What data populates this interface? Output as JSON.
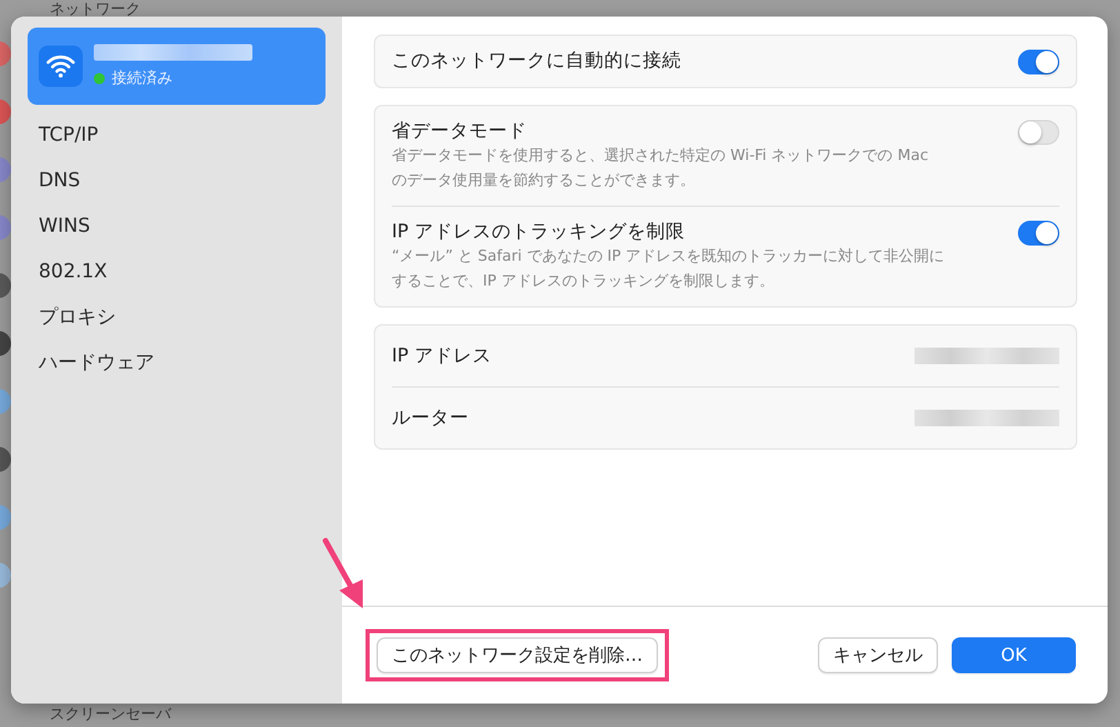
{
  "background": {
    "header": "ネットワーク",
    "footer_item": "スクリーンセーバ"
  },
  "sidebar": {
    "network": {
      "status": "接続済み",
      "connected": true,
      "selected": true
    },
    "items": [
      {
        "label": "TCP/IP",
        "selected": false
      },
      {
        "label": "DNS",
        "selected": false
      },
      {
        "label": "WINS",
        "selected": false
      },
      {
        "label": "802.1X",
        "selected": false
      },
      {
        "label": "プロキシ",
        "selected": false
      },
      {
        "label": "ハードウェア",
        "selected": false
      }
    ]
  },
  "groups": [
    {
      "kind": "toggles",
      "rows": [
        {
          "title": "このネットワークに自動的に接続",
          "on": true
        }
      ]
    },
    {
      "kind": "toggles",
      "rows": [
        {
          "title": "省データモード",
          "description": "省データモードを使用すると、選択された特定の Wi-Fi ネットワークでの Mac のデータ使用量を節約することができます。",
          "on": false
        },
        {
          "title": "IP アドレスのトラッキングを制限",
          "description": "“メール” と Safari であなたの IP アドレスを既知のトラッカーに対して非公開にすることで、IP アドレスのトラッキングを制限します。",
          "on": true
        }
      ]
    },
    {
      "kind": "info",
      "rows": [
        {
          "label": "IP アドレス",
          "redacted": true
        },
        {
          "label": "ルーター",
          "redacted": true
        }
      ]
    }
  ],
  "buttons": [
    {
      "label": "このネットワーク設定を削除…",
      "kind": "secondary",
      "highlighted": true
    },
    {
      "label": "キャンセル",
      "kind": "secondary",
      "highlighted": false
    },
    {
      "label": "OK",
      "kind": "primary",
      "highlighted": false
    }
  ]
}
